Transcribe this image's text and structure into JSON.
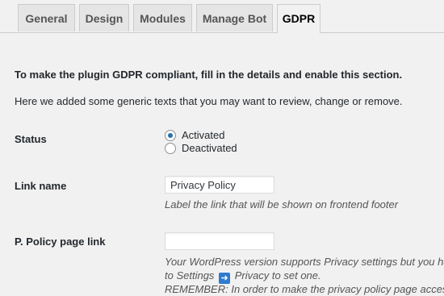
{
  "tabs": [
    {
      "label": "General",
      "active": false
    },
    {
      "label": "Design",
      "active": false
    },
    {
      "label": "Modules",
      "active": false
    },
    {
      "label": "Manage Bot",
      "active": false
    },
    {
      "label": "GDPR",
      "active": true
    }
  ],
  "gdpr": {
    "intro_bold": "To make the plugin GDPR compliant, fill in the details and enable this section.",
    "intro": "Here we added some generic texts that you may want to review, change or remove.",
    "status": {
      "label": "Status",
      "options": [
        {
          "label": "Activated",
          "checked": true
        },
        {
          "label": "Deactivated",
          "checked": false
        }
      ]
    },
    "link_name": {
      "label": "Link name",
      "value": "Privacy Policy",
      "description": "Label the link that will be shown on frontend footer"
    },
    "policy_link": {
      "label": "P. Policy page link",
      "value": "",
      "desc_line1": "Your WordPress version supports Privacy settings but you hav",
      "desc_line2_before": "to Settings",
      "desc_line2_icon": "right-arrow-icon",
      "desc_line2_after": "Privacy to set one.",
      "desc_line3": "REMEMBER: In order to make the privacy policy page accessib"
    }
  },
  "colors": {
    "radio_accent": "#2271b1",
    "arrow_badge": "#2e7bcf",
    "background": "#f1f1f1"
  }
}
